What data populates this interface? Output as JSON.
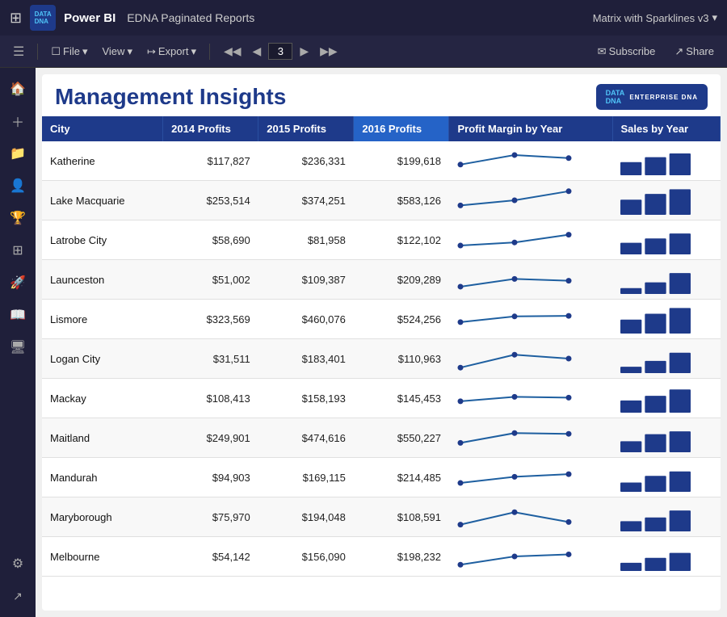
{
  "topbar": {
    "brand": "Power BI",
    "title": "EDNA Paginated Reports",
    "right_label": "Matrix with Sparklines v3",
    "chevron": "▾"
  },
  "toolbar": {
    "file_label": "File",
    "view_label": "View",
    "export_label": "Export",
    "page_number": "3",
    "subscribe_label": "Subscribe",
    "share_label": "Share"
  },
  "report": {
    "title": "Management Insights",
    "edna_label": "ENTERPRISE DNA"
  },
  "table": {
    "headers": [
      "City",
      "2014 Profits",
      "2015 Profits",
      "2016 Profits",
      "Profit Margin by Year",
      "Sales by Year"
    ],
    "rows": [
      {
        "city": "Katherine",
        "p2014": "$117,827",
        "p2015": "$236,331",
        "p2016": "$199,618",
        "spark": [
          0.35,
          0.72,
          0.6
        ],
        "bars": [
          0.45,
          0.62,
          0.75
        ]
      },
      {
        "city": "Lake Macquarie",
        "p2014": "$253,514",
        "p2015": "$374,251",
        "p2016": "$583,126",
        "spark": [
          0.3,
          0.5,
          0.85
        ],
        "bars": [
          0.52,
          0.72,
          0.88
        ]
      },
      {
        "city": "Latrobe City",
        "p2014": "$58,690",
        "p2015": "$81,958",
        "p2016": "$122,102",
        "spark": [
          0.28,
          0.4,
          0.7
        ],
        "bars": [
          0.4,
          0.55,
          0.72
        ]
      },
      {
        "city": "Launceston",
        "p2014": "$51,002",
        "p2015": "$109,387",
        "p2016": "$209,289",
        "spark": [
          0.22,
          0.52,
          0.45
        ],
        "bars": [
          0.2,
          0.4,
          0.72
        ]
      },
      {
        "city": "Lismore",
        "p2014": "$323,569",
        "p2015": "$460,076",
        "p2016": "$524,256",
        "spark": [
          0.38,
          0.6,
          0.62
        ],
        "bars": [
          0.48,
          0.68,
          0.88
        ]
      },
      {
        "city": "Logan City",
        "p2014": "$31,511",
        "p2015": "$183,401",
        "p2016": "$110,963",
        "spark": [
          0.15,
          0.65,
          0.5
        ],
        "bars": [
          0.22,
          0.42,
          0.7
        ]
      },
      {
        "city": "Mackay",
        "p2014": "$108,413",
        "p2015": "$158,193",
        "p2016": "$145,453",
        "spark": [
          0.38,
          0.55,
          0.52
        ],
        "bars": [
          0.42,
          0.58,
          0.8
        ]
      },
      {
        "city": "Maitland",
        "p2014": "$249,901",
        "p2015": "$474,616",
        "p2016": "$550,227",
        "spark": [
          0.3,
          0.68,
          0.65
        ],
        "bars": [
          0.38,
          0.62,
          0.72
        ]
      },
      {
        "city": "Mandurah",
        "p2014": "$94,903",
        "p2015": "$169,115",
        "p2016": "$214,485",
        "spark": [
          0.28,
          0.52,
          0.62
        ],
        "bars": [
          0.32,
          0.55,
          0.7
        ]
      },
      {
        "city": "Maryborough",
        "p2014": "$75,970",
        "p2015": "$194,048",
        "p2016": "$108,591",
        "spark": [
          0.2,
          0.68,
          0.3
        ],
        "bars": [
          0.35,
          0.48,
          0.72
        ]
      },
      {
        "city": "Melbourne",
        "p2014": "$54,142",
        "p2015": "$156,090",
        "p2016": "$198,232",
        "spark": [
          0.18,
          0.5,
          0.58
        ],
        "bars": [
          0.28,
          0.45,
          0.62
        ]
      }
    ]
  },
  "sidebar": {
    "items": [
      "⊞",
      "☰",
      "🏠",
      "+",
      "📁",
      "👤",
      "🏆",
      "⊡",
      "🚀",
      "📖",
      "🖥",
      "⚙"
    ]
  }
}
